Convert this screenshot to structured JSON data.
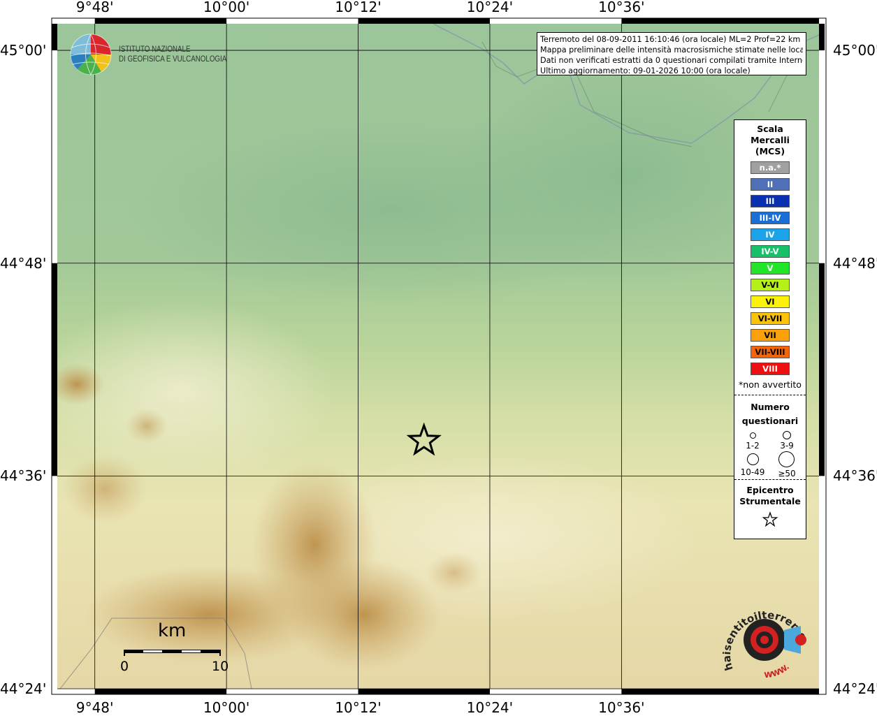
{
  "map": {
    "lon_labels": [
      "9°48'",
      "10°00'",
      "10°12'",
      "10°24'",
      "10°36'"
    ],
    "lat_labels": [
      "45°00'",
      "44°48'",
      "44°36'",
      "44°24'"
    ],
    "lon_degrees": [
      9.8,
      10.0,
      10.2,
      10.4,
      10.6
    ],
    "lat_degrees": [
      45.0,
      44.8,
      44.6,
      44.4
    ],
    "extent": {
      "lon_min": 9.743,
      "lon_max": 10.9,
      "lat_min": 44.4,
      "lat_max": 45.025
    },
    "epicenter": {
      "lon": 10.3,
      "lat": 44.633,
      "symbol": "star-icon"
    }
  },
  "info": {
    "line1": "Terremoto del 08-09-2011 16:10:46 (ora locale) ML=2 Prof=22 km",
    "line2": "Mappa preliminare delle intensità macrosismiche stimate nelle località",
    "line3": "Dati non verificati estratti da 0 questionari compilati tramite Internet.",
    "line4": "Ultimo aggiornamento: 09-01-2026 10:00 (ora locale)"
  },
  "legend": {
    "title1": "Scala",
    "title2": "Mercalli",
    "title3": "(MCS)",
    "items": [
      {
        "label": "n.a.*",
        "color": "#a0a0a0"
      },
      {
        "label": "II",
        "color": "#4f6fb6"
      },
      {
        "label": "III",
        "color": "#0a2fb0"
      },
      {
        "label": "III-IV",
        "color": "#1a6fd6"
      },
      {
        "label": "IV",
        "color": "#1aa3e8"
      },
      {
        "label": "IV-V",
        "color": "#18c06a"
      },
      {
        "label": "V",
        "color": "#22e52a"
      },
      {
        "label": "V-VI",
        "color": "#b6f01a"
      },
      {
        "label": "VI",
        "color": "#fbf20a"
      },
      {
        "label": "VI-VII",
        "color": "#fbc20a"
      },
      {
        "label": "VII",
        "color": "#f9a00a"
      },
      {
        "label": "VII-VIII",
        "color": "#f4650a"
      },
      {
        "label": "VIII",
        "color": "#ee1010"
      }
    ],
    "note": "*non avvertito",
    "questionari_title1": "Numero",
    "questionari_title2": "questionari",
    "circle_labels": [
      "1-2",
      "3-9",
      "10-49",
      "≥50"
    ],
    "epicentro_title1": "Epicentro",
    "epicentro_title2": "Strumentale"
  },
  "logo": {
    "line1": "ISTITUTO NAZIONALE",
    "line2": "DI GEOFISICA E VULCANOLOGIA"
  },
  "scale": {
    "unit": "km",
    "start": "0",
    "end": "10"
  },
  "brand": {
    "text": "haisentitoilterremoto.it",
    "url_text": "WWW."
  }
}
